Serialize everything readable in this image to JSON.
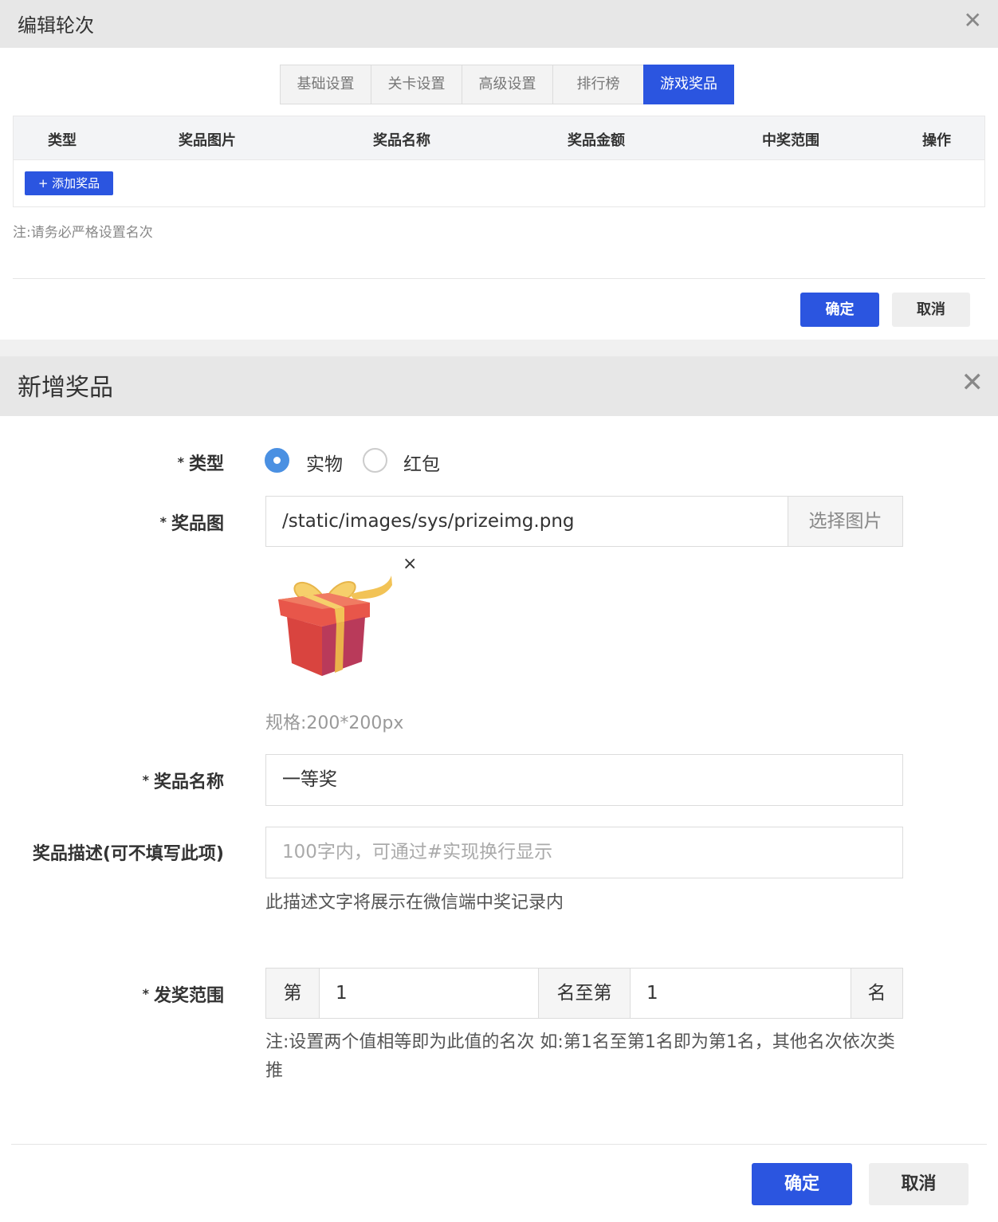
{
  "panel1": {
    "title": "编辑轮次",
    "close": "✕",
    "tabs": [
      "基础设置",
      "关卡设置",
      "高级设置",
      "排行榜",
      "游戏奖品"
    ],
    "active_tab": "游戏奖品",
    "table_headers": [
      "类型",
      "奖品图片",
      "奖品名称",
      "奖品金额",
      "中奖范围",
      "操作"
    ],
    "add_button": "+ 添加奖品",
    "note": "注:请务必严格设置名次",
    "ok": "确定",
    "cancel": "取消"
  },
  "panel2": {
    "title": "新增奖品",
    "close": "✕",
    "type_label": "类型",
    "type_options": [
      "实物",
      "红包"
    ],
    "type_selected": "实物",
    "image_label": "奖品图",
    "image_path": "/static/images/sys/prizeimg.png",
    "choose_image": "选择图片",
    "remove_image": "×",
    "image_spec": "规格:200*200px",
    "name_label": "奖品名称",
    "name_value": "一等奖",
    "desc_label": "奖品描述(可不填写此项)",
    "desc_placeholder": "100字内，可通过#实现换行显示",
    "desc_help": "此描述文字将展示在微信端中奖记录内",
    "range_label": "发奖范围",
    "range_prefix": "第",
    "range_from": "1",
    "range_middle": "名至第",
    "range_to": "1",
    "range_suffix": "名",
    "range_note": "注:设置两个值相等即为此值的名次 如:第1名至第1名即为第1名，其他名次依次类推",
    "ok": "确定",
    "cancel": "取消"
  },
  "colors": {
    "primary": "#2b55e0",
    "radio": "#4a90e2",
    "header_bg": "#e7e7e7"
  }
}
